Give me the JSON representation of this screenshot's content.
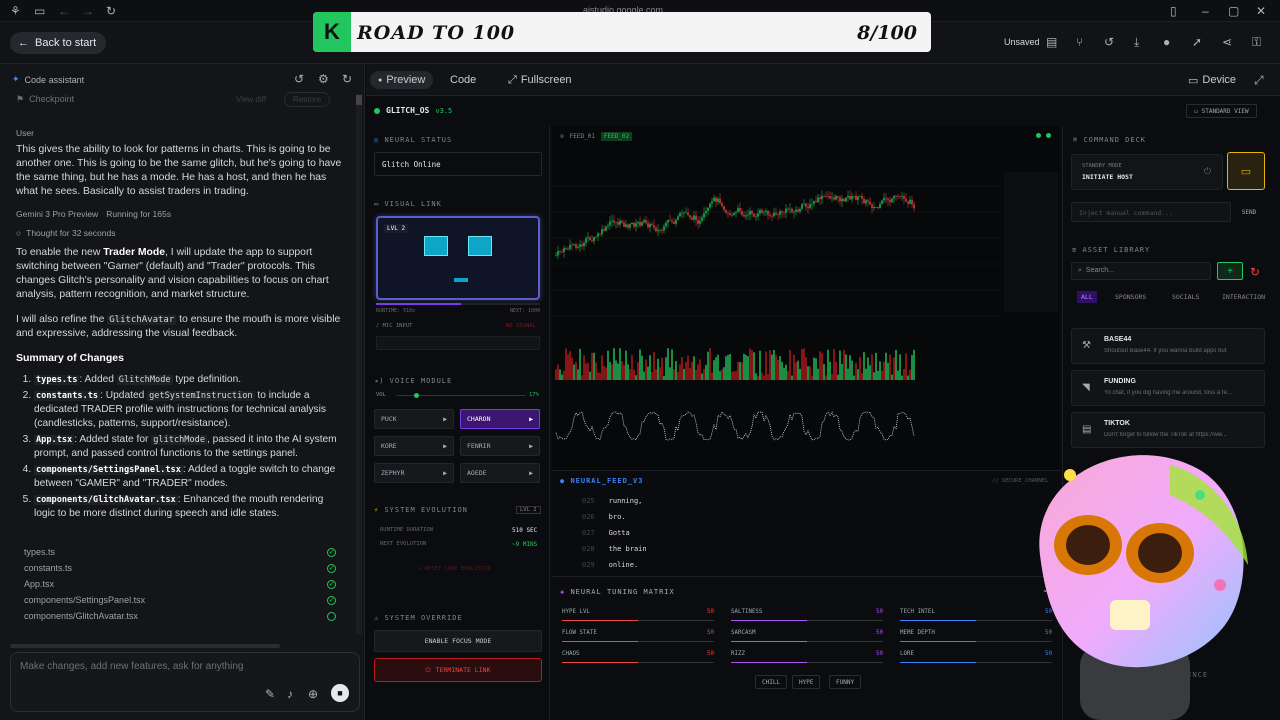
{
  "banner": {
    "badge": "K",
    "title": "ROAD TO 100",
    "count": "8/100"
  },
  "topbar": {
    "url": "aistudio.google.com"
  },
  "appbar": {
    "back_label": "Back to start",
    "unsaved": "Unsaved"
  },
  "left": {
    "header": "Code assistant",
    "checkpoint": "Checkpoint",
    "view_diff": "View diff",
    "restore": "Restore",
    "user_label": "User",
    "user_msg": "This gives the ability to look for patterns in charts. This is going to be another one. This is going to be the same glitch, but he's going to have the same thing, but he has a mode. He has a host, and then he has what he sees. Basically to assist traders in trading.",
    "model": "Gemini 3 Pro Preview",
    "running": "Running for 165s",
    "thought": "Thought for 32 seconds",
    "p1a": "To enable the new ",
    "p1b": "Trader Mode",
    "p1c": ", I will update the app to support switching between \"Gamer\" (default) and \"Trader\" protocols. This changes Glitch's personality and vision capabilities to focus on chart analysis, pattern recognition, and market structure.",
    "p2a": "I will also refine the ",
    "p2b": "GlitchAvatar",
    "p2c": " to ensure the mouth is more visible and expressive, addressing the visual feedback.",
    "summary": "Summary of Changes",
    "items": [
      {
        "file": "types.ts",
        "text": ": Added ",
        "code": "GlitchMode",
        "tail": " type definition."
      },
      {
        "file": "constants.ts",
        "text": ": Updated ",
        "code": "getSystemInstruction",
        "tail": " to include a dedicated TRADER profile with instructions for technical analysis (candlesticks, patterns, support/resistance)."
      },
      {
        "file": "App.tsx",
        "text": ": Added state for ",
        "code": "glitchMode",
        "tail": ", passed it into the AI system prompt, and passed control functions to the settings panel."
      },
      {
        "file": "components/SettingsPanel.tsx",
        "text": ": Added a toggle switch to change between \"GAMER\" and \"TRADER\" modes.",
        "code": "",
        "tail": ""
      },
      {
        "file": "components/GlitchAvatar.tsx",
        "text": ": Enhanced the mouth rendering logic to be more distinct during speech and idle states.",
        "code": "",
        "tail": ""
      }
    ],
    "files": [
      "types.ts",
      "constants.ts",
      "App.tsx",
      "components/SettingsPanel.tsx",
      "components/GlitchAvatar.tsx"
    ],
    "input_placeholder": "Make changes, add new features, ask for anything"
  },
  "preview": {
    "tab_preview": "Preview",
    "tab_code": "Code",
    "tab_full": "Fullscreen",
    "device": "Device"
  },
  "glitch": {
    "title": "GLITCH_OS",
    "version": "v3.5",
    "std_view": "STANDARD VIEW",
    "neural_status": "NEURAL STATUS",
    "status_val": "Glitch Online",
    "visual_link": "VISUAL LINK",
    "lvl": "LVL 2",
    "runtime": "RUNTIME: 510s",
    "next": "NEXT: 1000",
    "mic": "MIC INPUT",
    "no_signal": "NO SIGNAL",
    "voice": "VOICE MODULE",
    "vol": "VOL",
    "vol_val": "17%",
    "voices": [
      "PUCK",
      "CHARON",
      "KORE",
      "FENRIR",
      "ZEPHYR",
      "AOEDE"
    ],
    "evo": "SYSTEM EVOLUTION",
    "evo_lvl": "LVL 2",
    "rt_label": "RUNTIME DURATION",
    "rt_val": "510 SEC",
    "ne_label": "NEXT EVOLUTION",
    "ne_val": "~9 MINS",
    "reset": "RESET CORE EVOLUTION",
    "override": "SYSTEM OVERRIDE",
    "focus": "ENABLE FOCUS MODE",
    "terminate": "TERMINATE LINK",
    "feed1": "FEED_01",
    "feed2": "FEED_02",
    "nf_title": "NEURAL_FEED_V3",
    "secure": "// SECURE_CHANNEL",
    "feed_lines": [
      {
        "n": "025",
        "t": "running,"
      },
      {
        "n": "026",
        "t": "bro."
      },
      {
        "n": "027",
        "t": "Gotta"
      },
      {
        "n": "028",
        "t": "the brain"
      },
      {
        "n": "029",
        "t": "online."
      }
    ],
    "tuning": "NEURAL TUNING MATRIX",
    "tunes": [
      {
        "l": "HYPE LVL",
        "v": "50",
        "c": "#ef4444"
      },
      {
        "l": "SALTINESS",
        "v": "50",
        "c": "#a855f7"
      },
      {
        "l": "TECH INTEL",
        "v": "50",
        "c": "#3b82f6"
      },
      {
        "l": "FLOW STATE",
        "v": "50",
        "c": "#ef4444"
      },
      {
        "l": "SARCASM",
        "v": "50",
        "c": "#a855f7"
      },
      {
        "l": "MEME DEPTH",
        "v": "50",
        "c": "#3b82f6"
      },
      {
        "l": "CHAOS",
        "v": "50",
        "c": "#ef4444"
      },
      {
        "l": "RIZZ",
        "v": "50",
        "c": "#a855f7"
      },
      {
        "l": "LORE",
        "v": "50",
        "c": "#3b82f6"
      }
    ],
    "presets": [
      "CHILL",
      "HYPE",
      "FUNNY"
    ],
    "cmd": "COMMAND DECK",
    "standby": "STANDBY MODE",
    "initiate": "INITIATE HOST",
    "inject": "Inject manual command...",
    "send": "SEND",
    "lib": "ASSET LIBRARY",
    "search": "Search...",
    "lib_tabs": [
      "ALL",
      "SPONSORS",
      "SOCIALS",
      "INTERACTION"
    ],
    "assets": [
      {
        "n": "BASE44",
        "d": "Shoutout Base44. If you wanna build apps but"
      },
      {
        "n": "FUNDING",
        "d": "Yo chat, if you dig having me around, toss a fe..."
      },
      {
        "n": "TIKTOK",
        "d": "Don't forget to follow the TikTok at https://ww..."
      }
    ],
    "deploy": "DEPLOY SEQUENCE"
  }
}
